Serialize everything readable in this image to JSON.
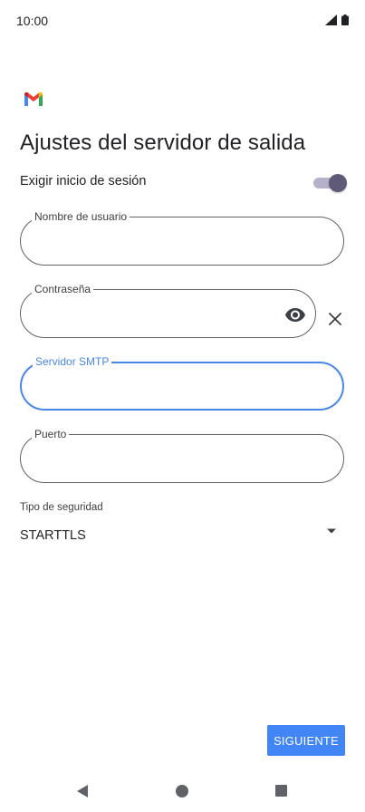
{
  "status_bar": {
    "time": "10:00"
  },
  "app": {
    "logo_icon": "gmail-logo"
  },
  "page": {
    "title": "Ajustes del servidor de salida"
  },
  "require_login": {
    "label": "Exigir inicio de sesión",
    "enabled": true
  },
  "fields": {
    "username": {
      "label": "Nombre de usuario",
      "value": ""
    },
    "password": {
      "label": "Contraseña",
      "value": ""
    },
    "smtp_server": {
      "label": "Servidor SMTP",
      "value": ""
    },
    "port": {
      "label": "Puerto",
      "value": ""
    }
  },
  "security": {
    "label": "Tipo de seguridad",
    "selected": "STARTTLS"
  },
  "actions": {
    "next_label": "SIGUIENTE"
  },
  "colors": {
    "accent": "#4285f4",
    "focus": "#4a86e8",
    "switch_thumb": "#5e5a78",
    "switch_track": "#b6b1c9"
  },
  "icons": {
    "visibility": "eye-icon",
    "clear": "close-icon",
    "dropdown": "dropdown-arrow-icon",
    "signal": "signal-icon",
    "battery": "battery-icon"
  }
}
